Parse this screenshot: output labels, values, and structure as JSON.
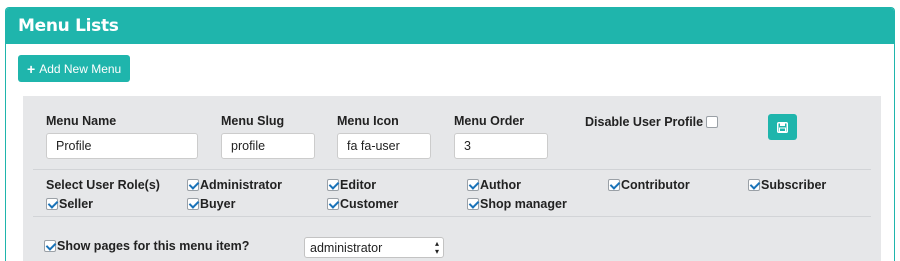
{
  "panel": {
    "title": "Menu Lists"
  },
  "toolbar": {
    "add_label": "Add New Menu",
    "add_icon": "plus-icon"
  },
  "form": {
    "menu_name": {
      "label": "Menu Name",
      "value": "Profile"
    },
    "menu_slug": {
      "label": "Menu Slug",
      "value": "profile"
    },
    "menu_icon": {
      "label": "Menu Icon",
      "value": "fa fa-user"
    },
    "menu_order": {
      "label": "Menu Order",
      "value": "3"
    },
    "disable_profile": {
      "label": "Disable User Profile",
      "checked": false
    },
    "save_icon": "floppy-disk-icon"
  },
  "roles": {
    "label": "Select User Role(s)",
    "items": [
      {
        "label": "Administrator",
        "checked": true
      },
      {
        "label": "Editor",
        "checked": true
      },
      {
        "label": "Author",
        "checked": true
      },
      {
        "label": "Contributor",
        "checked": true
      },
      {
        "label": "Subscriber",
        "checked": true
      },
      {
        "label": "Seller",
        "checked": true
      },
      {
        "label": "Buyer",
        "checked": true
      },
      {
        "label": "Customer",
        "checked": true
      },
      {
        "label": "Shop manager",
        "checked": true
      }
    ]
  },
  "pages": {
    "label": "Show pages for this menu item?",
    "checked": true,
    "select_value": "administrator"
  },
  "colors": {
    "accent": "#1fb5ac",
    "box_bg": "#e6e7e9",
    "check": "#1a73b8"
  }
}
